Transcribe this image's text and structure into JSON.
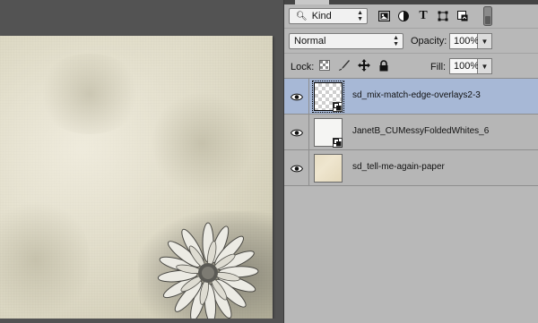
{
  "filter_bar": {
    "kind_label": "Kind",
    "icons": [
      "pixel-layer-filter-icon",
      "adjustment-layer-filter-icon",
      "type-layer-filter-icon",
      "shape-layer-filter-icon",
      "smart-object-filter-icon",
      "filter-toggle-icon"
    ]
  },
  "blend": {
    "mode": "Normal",
    "opacity_label": "Opacity:",
    "opacity_value": "100%"
  },
  "lock": {
    "label": "Lock:",
    "icons": [
      "lock-transparent-pixels-icon",
      "lock-image-pixels-icon",
      "lock-position-icon",
      "lock-all-icon"
    ],
    "fill_label": "Fill:",
    "fill_value": "100%"
  },
  "layers": [
    {
      "name": "sd_mix-match-edge-overlays2-3",
      "selected": true,
      "thumb": "transparent",
      "smart_object": true,
      "visible": true
    },
    {
      "name": "JanetB_CUMessyFoldedWhites_6",
      "selected": false,
      "thumb": "white",
      "smart_object": true,
      "visible": true
    },
    {
      "name": "sd_tell-me-again-paper",
      "selected": false,
      "thumb": "paper",
      "smart_object": false,
      "visible": true
    }
  ],
  "colors": {
    "panel_bg": "#b8b8b8",
    "selected_row": "#a7b8d6",
    "app_bg": "#535353"
  }
}
